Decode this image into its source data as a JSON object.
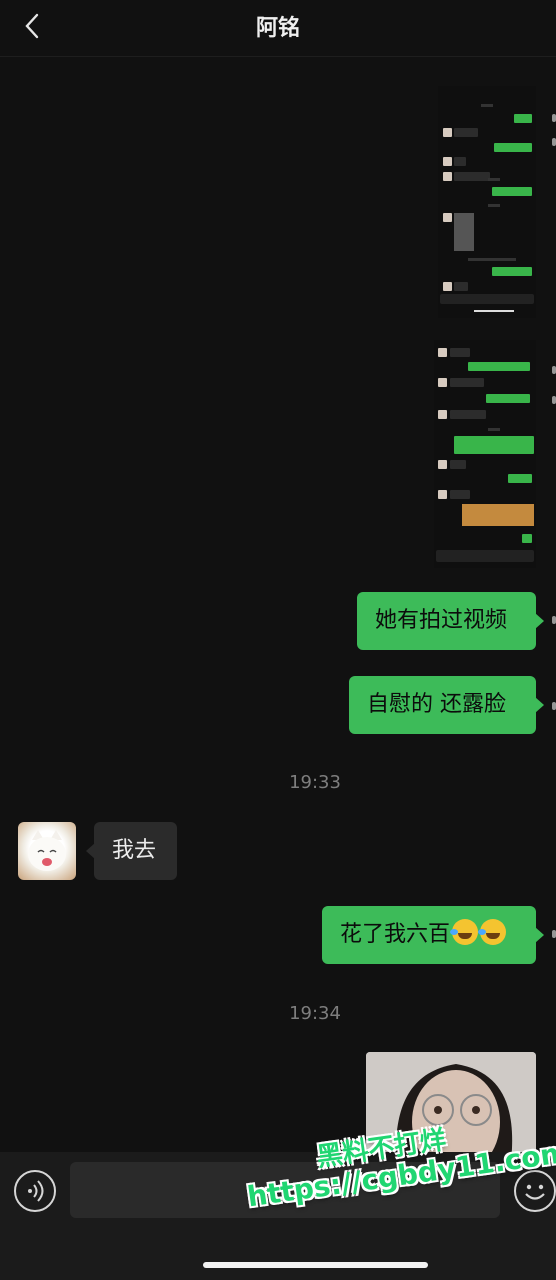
{
  "header": {
    "title": "阿铭"
  },
  "messages": {
    "m1": "她有拍过视频",
    "m2": "自慰的 还露脸",
    "time1": "19:33",
    "m3": "我去",
    "m4": "花了我六百",
    "time2": "19:34"
  },
  "watermark": {
    "line1": "黑料不打烊",
    "line2": "https://cgbdy11.com"
  },
  "colors": {
    "background": "#111111",
    "bubble_sent": "#3dbb59",
    "bubble_received": "#2b2b2b",
    "watermark": "#20d672"
  },
  "icons": {
    "back": "chevron-left-icon",
    "voice": "voice-icon",
    "emoji": "emoji-icon",
    "laugh": "laughing-emoji-icon"
  }
}
